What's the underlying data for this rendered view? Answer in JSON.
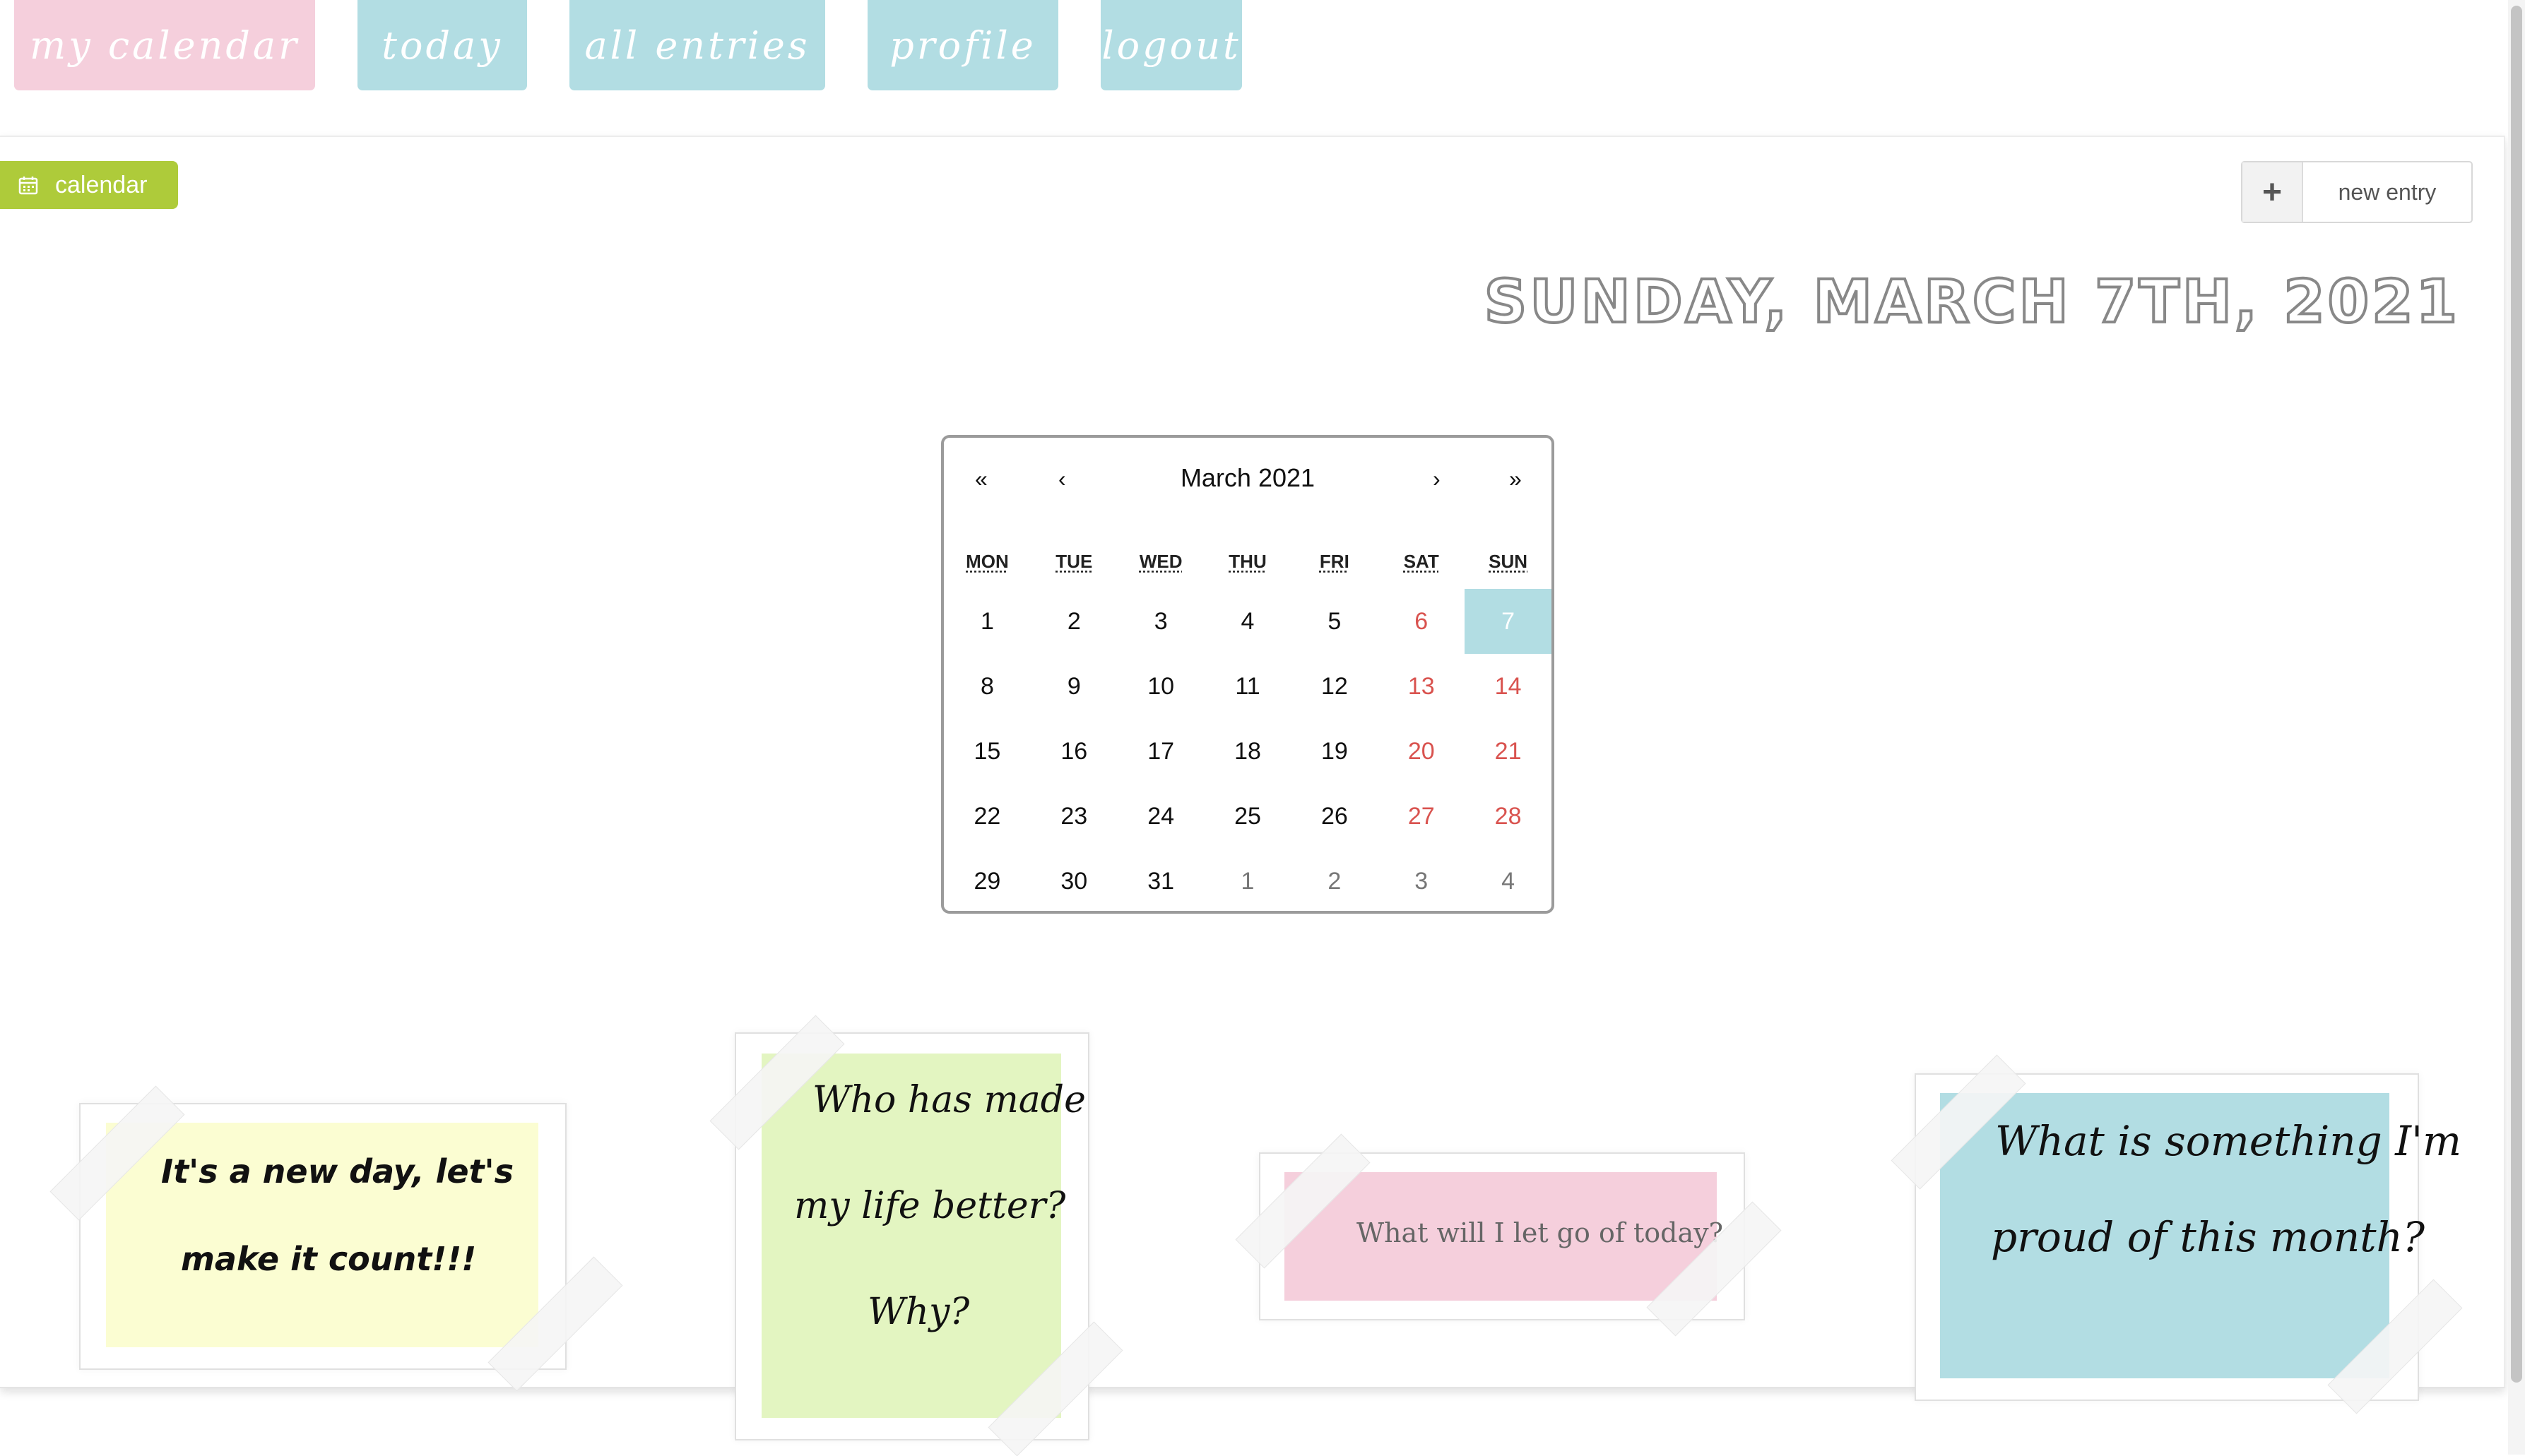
{
  "nav": {
    "items": [
      {
        "label": "my calendar",
        "color": "#f5cfdc"
      },
      {
        "label": "today",
        "color": "#b2dde3"
      },
      {
        "label": "all entries",
        "color": "#b2dde3"
      },
      {
        "label": "profile",
        "color": "#b2dde3"
      },
      {
        "label": "logout",
        "color": "#b2dde3"
      }
    ]
  },
  "badge": {
    "label": "calendar",
    "icon": "calendar-icon",
    "color": "#aecb3a"
  },
  "new_entry": {
    "icon": "plus-icon",
    "label": "new entry"
  },
  "date_heading": "Sunday, March 7th, 2021",
  "calendar": {
    "nav": {
      "first": "«",
      "prev": "‹",
      "next": "›",
      "last": "»"
    },
    "month_label": "March 2021",
    "weekdays": [
      "MON",
      "TUE",
      "WED",
      "THU",
      "FRI",
      "SAT",
      "SUN"
    ],
    "weeks": [
      [
        "1",
        "2",
        "3",
        "4",
        "5",
        "6",
        "7"
      ],
      [
        "8",
        "9",
        "10",
        "11",
        "12",
        "13",
        "14"
      ],
      [
        "15",
        "16",
        "17",
        "18",
        "19",
        "20",
        "21"
      ],
      [
        "22",
        "23",
        "24",
        "25",
        "26",
        "27",
        "28"
      ],
      [
        "29",
        "30",
        "31",
        "1",
        "2",
        "3",
        "4"
      ]
    ],
    "selected_day": "7",
    "weekend_color": "#d9534f",
    "selected_color": "#b2dde3"
  },
  "notes": [
    {
      "lines": [
        "It's a new day, let's",
        "make it count!!!"
      ],
      "color": "#fbfdd2"
    },
    {
      "lines": [
        "Who has made",
        "my life better?",
        "Why?"
      ],
      "color": "#e3f5c1"
    },
    {
      "lines": [
        "What will I let go of today?"
      ],
      "color": "#f5cfdc"
    },
    {
      "lines": [
        "What is something I'm",
        "proud of this month?"
      ],
      "color": "#b2dde3"
    }
  ]
}
